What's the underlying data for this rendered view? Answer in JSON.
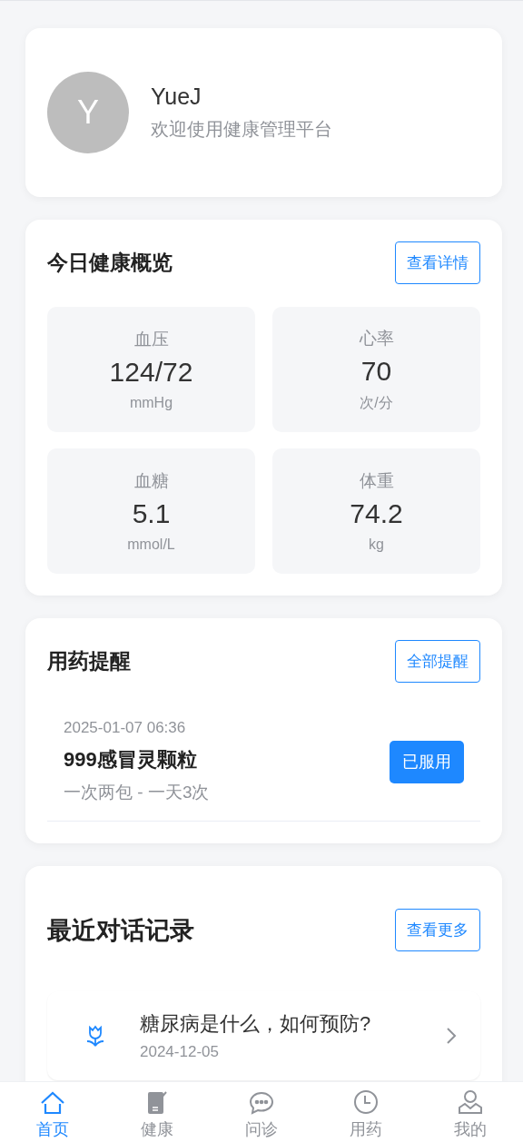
{
  "profile": {
    "avatar_letter": "Y",
    "name": "YueJ",
    "subtitle": "欢迎使用健康管理平台"
  },
  "overview": {
    "title": "今日健康概览",
    "button": "查看详情",
    "metrics": [
      {
        "label": "血压",
        "value": "124/72",
        "unit": "mmHg"
      },
      {
        "label": "心率",
        "value": "70",
        "unit": "次/分"
      },
      {
        "label": "血糖",
        "value": "5.1",
        "unit": "mmol/L"
      },
      {
        "label": "体重",
        "value": "74.2",
        "unit": "kg"
      }
    ]
  },
  "reminders": {
    "title": "用药提醒",
    "button": "全部提醒",
    "items": [
      {
        "time": "2025-01-07 06:36",
        "name": "999感冒灵颗粒",
        "dosage": "一次两包 - 一天3次",
        "button": "已服用"
      }
    ]
  },
  "chats": {
    "title": "最近对话记录",
    "button": "查看更多",
    "items": [
      {
        "question": "糖尿病是什么，如何预防?",
        "date": "2024-12-05"
      }
    ]
  },
  "tab_bar": [
    {
      "label": "首页",
      "selected": true
    },
    {
      "label": "健康",
      "selected": false
    },
    {
      "label": "问诊",
      "selected": false
    },
    {
      "label": "用药",
      "selected": false
    },
    {
      "label": "我的",
      "selected": false
    }
  ]
}
